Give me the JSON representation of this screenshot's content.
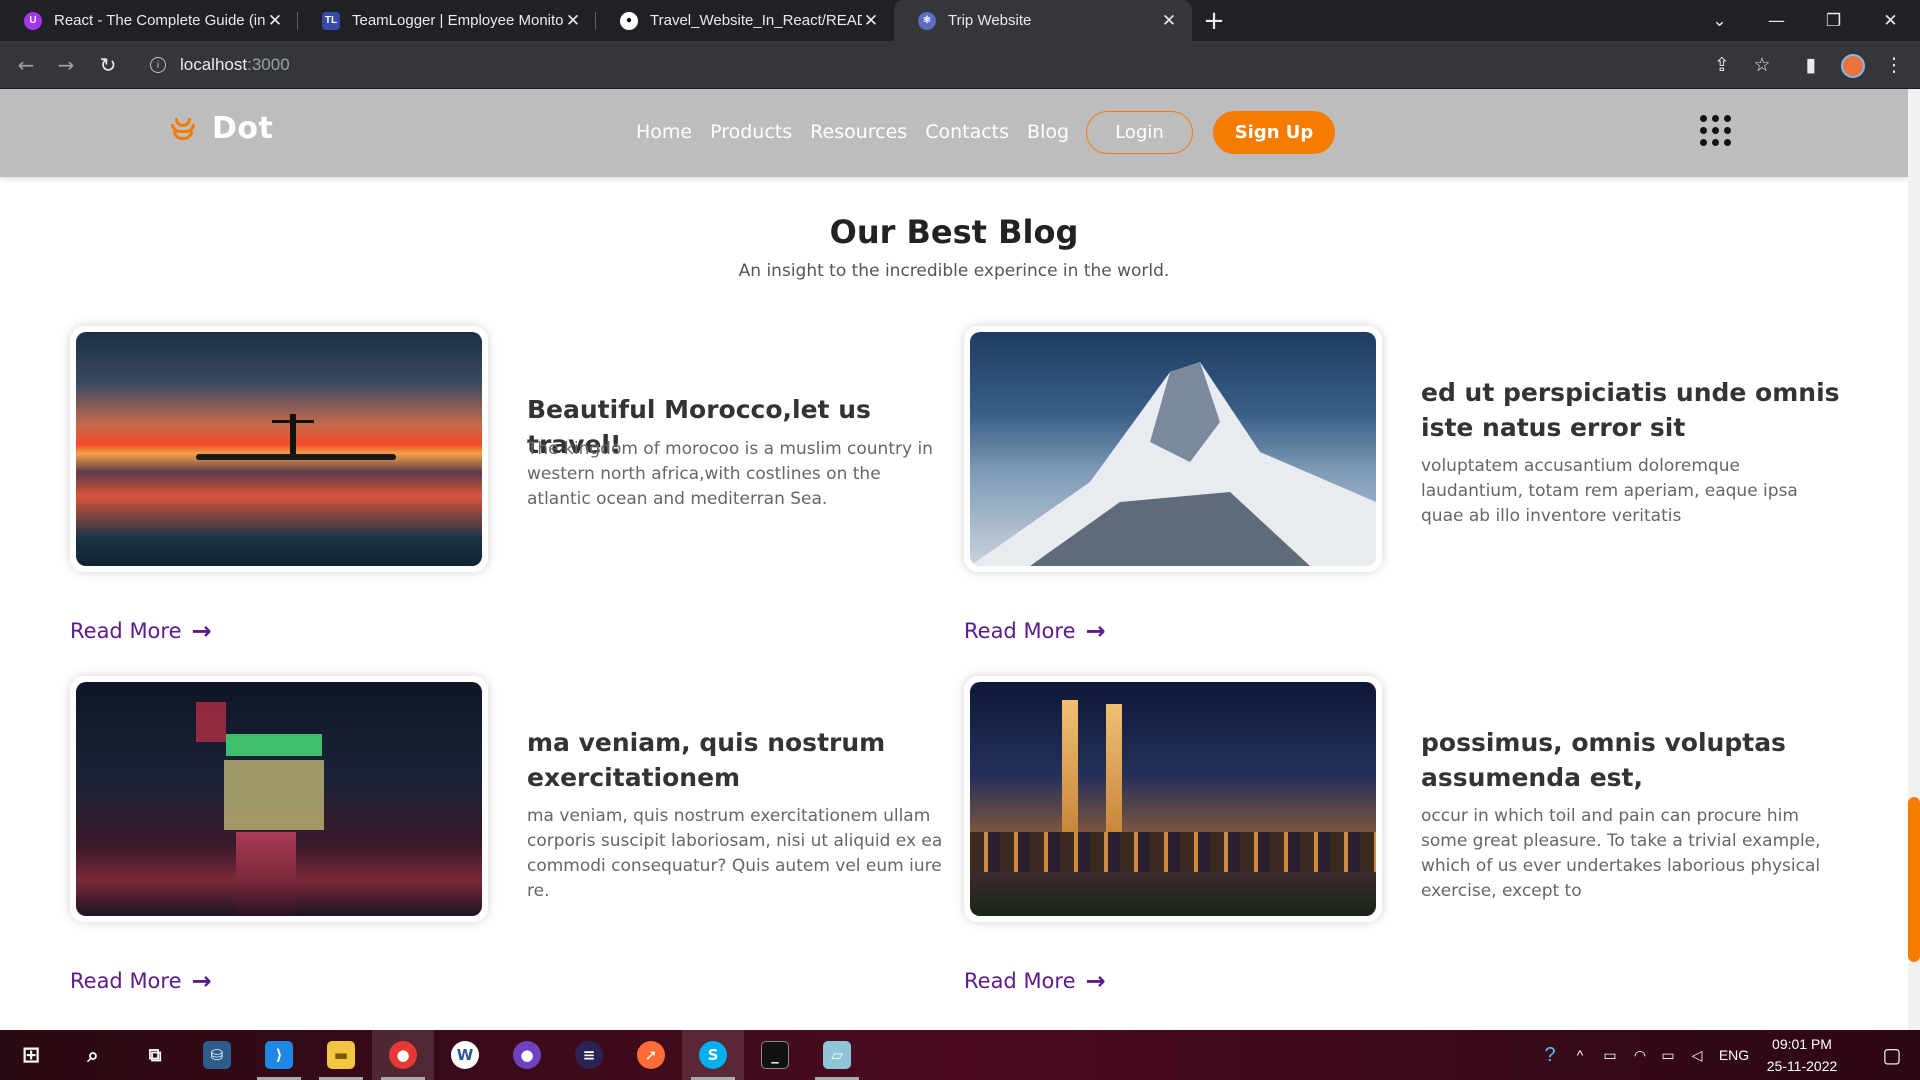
{
  "browser": {
    "tabs": [
      {
        "title": "React - The Complete Guide (incl",
        "favicon": "udemy-icon",
        "active": false
      },
      {
        "title": "TeamLogger | Employee Monitor",
        "favicon": "teamlogger-icon",
        "active": false
      },
      {
        "title": "Travel_Website_In_React/READM",
        "favicon": "github-icon",
        "active": false
      },
      {
        "title": "Trip Website",
        "favicon": "react-icon",
        "active": true
      }
    ],
    "url_host": "localhost",
    "url_port": ":3000"
  },
  "site": {
    "logo": "Dot",
    "nav_links": [
      "Home",
      "Products",
      "Resources",
      "Contacts",
      "Blog"
    ],
    "login": "Login",
    "signup": "Sign Up",
    "accent": "#f57c00"
  },
  "blog": {
    "title": "Our Best Blog",
    "subtitle": "An insight to the incredible experince in the world.",
    "read_more": "Read More",
    "posts": [
      {
        "title": "Beautiful Morocco,let us travel!",
        "text": "The kingdom of morocoo is a muslim country in western north africa,with costlines on the atlantic ocean and mediterran Sea.",
        "image": "sunset-beach-silhouette"
      },
      {
        "title": "ed ut perspiciatis unde omnis iste natus error sit",
        "text": "voluptatem accusantium doloremque laudantium, totam rem aperiam, eaque ipsa quae ab illo inventore veritatis",
        "image": "snowy-mountain-peak"
      },
      {
        "title": "ma veniam, quis nostrum exercitationem",
        "text": "ma veniam, quis nostrum exercitationem ullam corporis suscipit laboriosam, nisi ut aliquid ex ea commodi consequatur? Quis autem vel eum iure re.",
        "image": "neon-city-street-night"
      },
      {
        "title": "possimus, omnis voluptas assumenda est,",
        "text": "occur in which toil and pain can procure him some great pleasure. To take a trivial example, which of us ever undertakes laborious physical exercise, except to",
        "image": "petronas-towers-night"
      }
    ]
  },
  "taskbar": {
    "lang": "ENG",
    "time": "09:01 PM",
    "date": "25-11-2022"
  }
}
